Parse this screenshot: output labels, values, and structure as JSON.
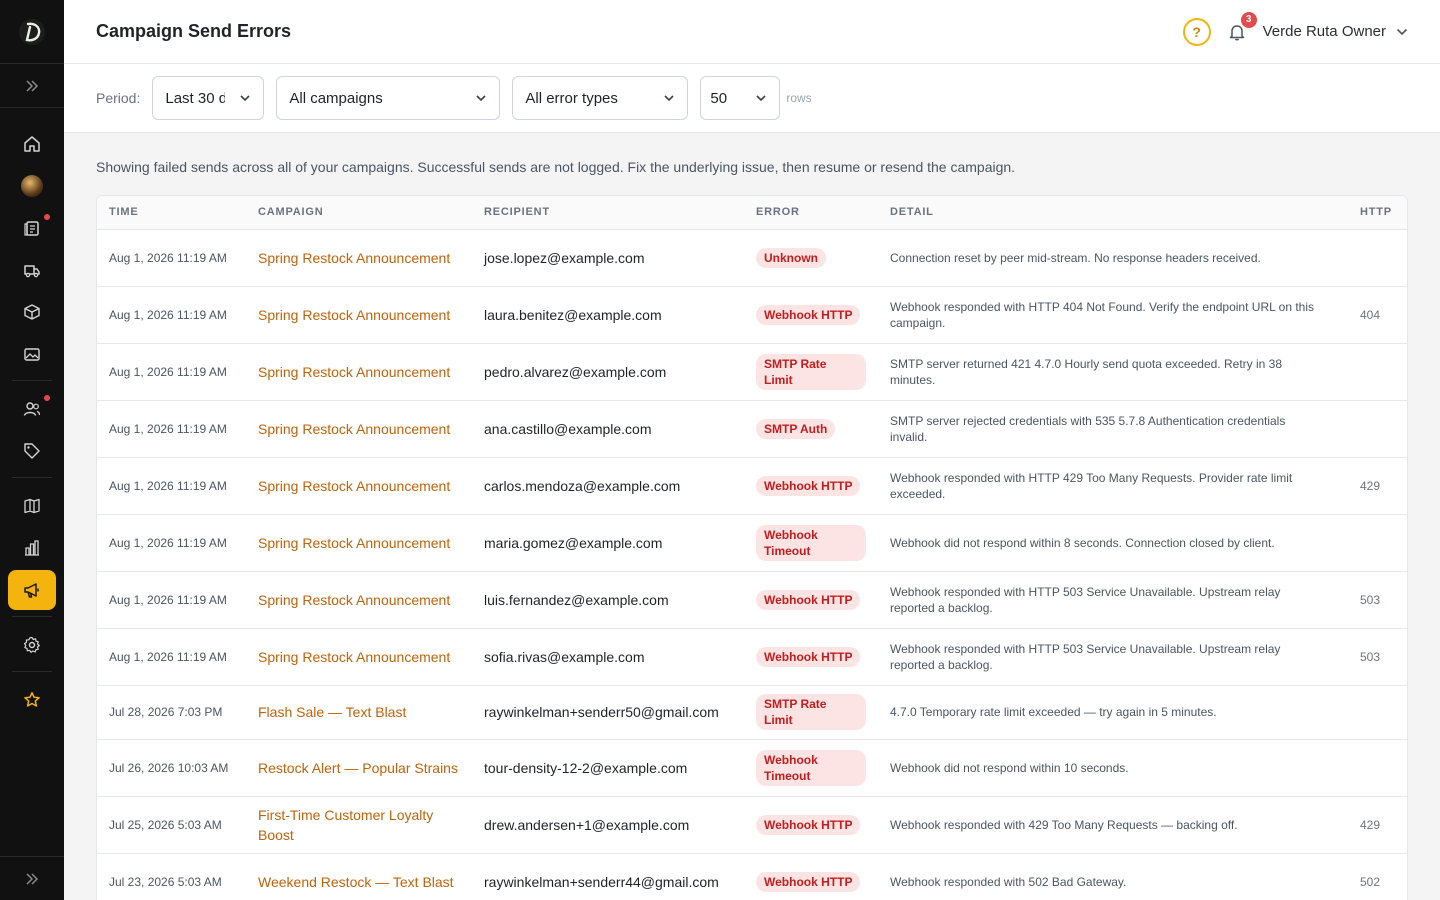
{
  "header": {
    "title": "Campaign Send Errors",
    "help_label": "?",
    "notification_count": "3",
    "user_name": "Verde Ruta Owner"
  },
  "filters": {
    "period_label": "Period:",
    "period_value": "Last 30 d",
    "campaign_value": "All campaigns",
    "error_type_value": "All error types",
    "rows_value": "50",
    "rows_label": "rows"
  },
  "intro": "Showing failed sends across all of your campaigns. Successful sends are not logged. Fix the underlying issue, then resume or resend the campaign.",
  "table": {
    "columns": [
      "TIME",
      "CAMPAIGN",
      "RECIPIENT",
      "ERROR",
      "DETAIL",
      "HTTP"
    ],
    "rows": [
      {
        "time": "Aug 1, 2026 11:19 AM",
        "campaign": "Spring Restock Announcement",
        "recipient": "jose.lopez@example.com",
        "error": "Unknown",
        "detail": "Connection reset by peer mid-stream. No response headers received.",
        "http": ""
      },
      {
        "time": "Aug 1, 2026 11:19 AM",
        "campaign": "Spring Restock Announcement",
        "recipient": "laura.benitez@example.com",
        "error": "Webhook HTTP",
        "detail": "Webhook responded with HTTP 404 Not Found. Verify the endpoint URL on this campaign.",
        "http": "404"
      },
      {
        "time": "Aug 1, 2026 11:19 AM",
        "campaign": "Spring Restock Announcement",
        "recipient": "pedro.alvarez@example.com",
        "error": "SMTP Rate Limit",
        "detail": "SMTP server returned 421 4.7.0 Hourly send quota exceeded. Retry in 38 minutes.",
        "http": ""
      },
      {
        "time": "Aug 1, 2026 11:19 AM",
        "campaign": "Spring Restock Announcement",
        "recipient": "ana.castillo@example.com",
        "error": "SMTP Auth",
        "detail": "SMTP server rejected credentials with 535 5.7.8 Authentication credentials invalid.",
        "http": ""
      },
      {
        "time": "Aug 1, 2026 11:19 AM",
        "campaign": "Spring Restock Announcement",
        "recipient": "carlos.mendoza@example.com",
        "error": "Webhook HTTP",
        "detail": "Webhook responded with HTTP 429 Too Many Requests. Provider rate limit exceeded.",
        "http": "429"
      },
      {
        "time": "Aug 1, 2026 11:19 AM",
        "campaign": "Spring Restock Announcement",
        "recipient": "maria.gomez@example.com",
        "error": "Webhook Timeout",
        "detail": "Webhook did not respond within 8 seconds. Connection closed by client.",
        "http": ""
      },
      {
        "time": "Aug 1, 2026 11:19 AM",
        "campaign": "Spring Restock Announcement",
        "recipient": "luis.fernandez@example.com",
        "error": "Webhook HTTP",
        "detail": "Webhook responded with HTTP 503 Service Unavailable. Upstream relay reported a backlog.",
        "http": "503"
      },
      {
        "time": "Aug 1, 2026 11:19 AM",
        "campaign": "Spring Restock Announcement",
        "recipient": "sofia.rivas@example.com",
        "error": "Webhook HTTP",
        "detail": "Webhook responded with HTTP 503 Service Unavailable. Upstream relay reported a backlog.",
        "http": "503"
      },
      {
        "time": "Jul 28, 2026 7:03 PM",
        "campaign": "Flash Sale — Text Blast",
        "recipient": "raywinkelman+senderr50@gmail.com",
        "error": "SMTP Rate Limit",
        "detail": "4.7.0 Temporary rate limit exceeded — try again in 5 minutes.",
        "http": ""
      },
      {
        "time": "Jul 26, 2026 10:03 AM",
        "campaign": "Restock Alert — Popular Strains",
        "recipient": "tour-density-12-2@example.com",
        "error": "Webhook Timeout",
        "detail": "Webhook did not respond within 10 seconds.",
        "http": ""
      },
      {
        "time": "Jul 25, 2026 5:03 AM",
        "campaign": "First-Time Customer Loyalty Boost",
        "recipient": "drew.andersen+1@example.com",
        "error": "Webhook HTTP",
        "detail": "Webhook responded with 429 Too Many Requests — backing off.",
        "http": "429"
      },
      {
        "time": "Jul 23, 2026 5:03 AM",
        "campaign": "Weekend Restock — Text Blast",
        "recipient": "raywinkelman+senderr44@gmail.com",
        "error": "Webhook HTTP",
        "detail": "Webhook responded with 502 Bad Gateway.",
        "http": "502"
      }
    ]
  },
  "colors": {
    "accent": "#f5b40d",
    "link": "#c2620a",
    "error_badge_bg": "#fde4e4",
    "error_badge_text": "#c41d1d",
    "sidebar_bg": "#111111"
  },
  "sidebar": {
    "items": [
      {
        "icon": "home-icon"
      },
      {
        "icon": "avatar-image"
      },
      {
        "icon": "clipboard-icon",
        "dot": true
      },
      {
        "icon": "truck-icon"
      },
      {
        "icon": "box-icon"
      },
      {
        "icon": "image-icon"
      },
      {
        "icon": "users-icon",
        "dot": true
      },
      {
        "icon": "tag-icon"
      },
      {
        "icon": "book-icon"
      },
      {
        "icon": "bar-chart-icon"
      },
      {
        "icon": "megaphone-icon",
        "active": true
      },
      {
        "icon": "gear-icon"
      },
      {
        "icon": "star-icon"
      }
    ]
  }
}
